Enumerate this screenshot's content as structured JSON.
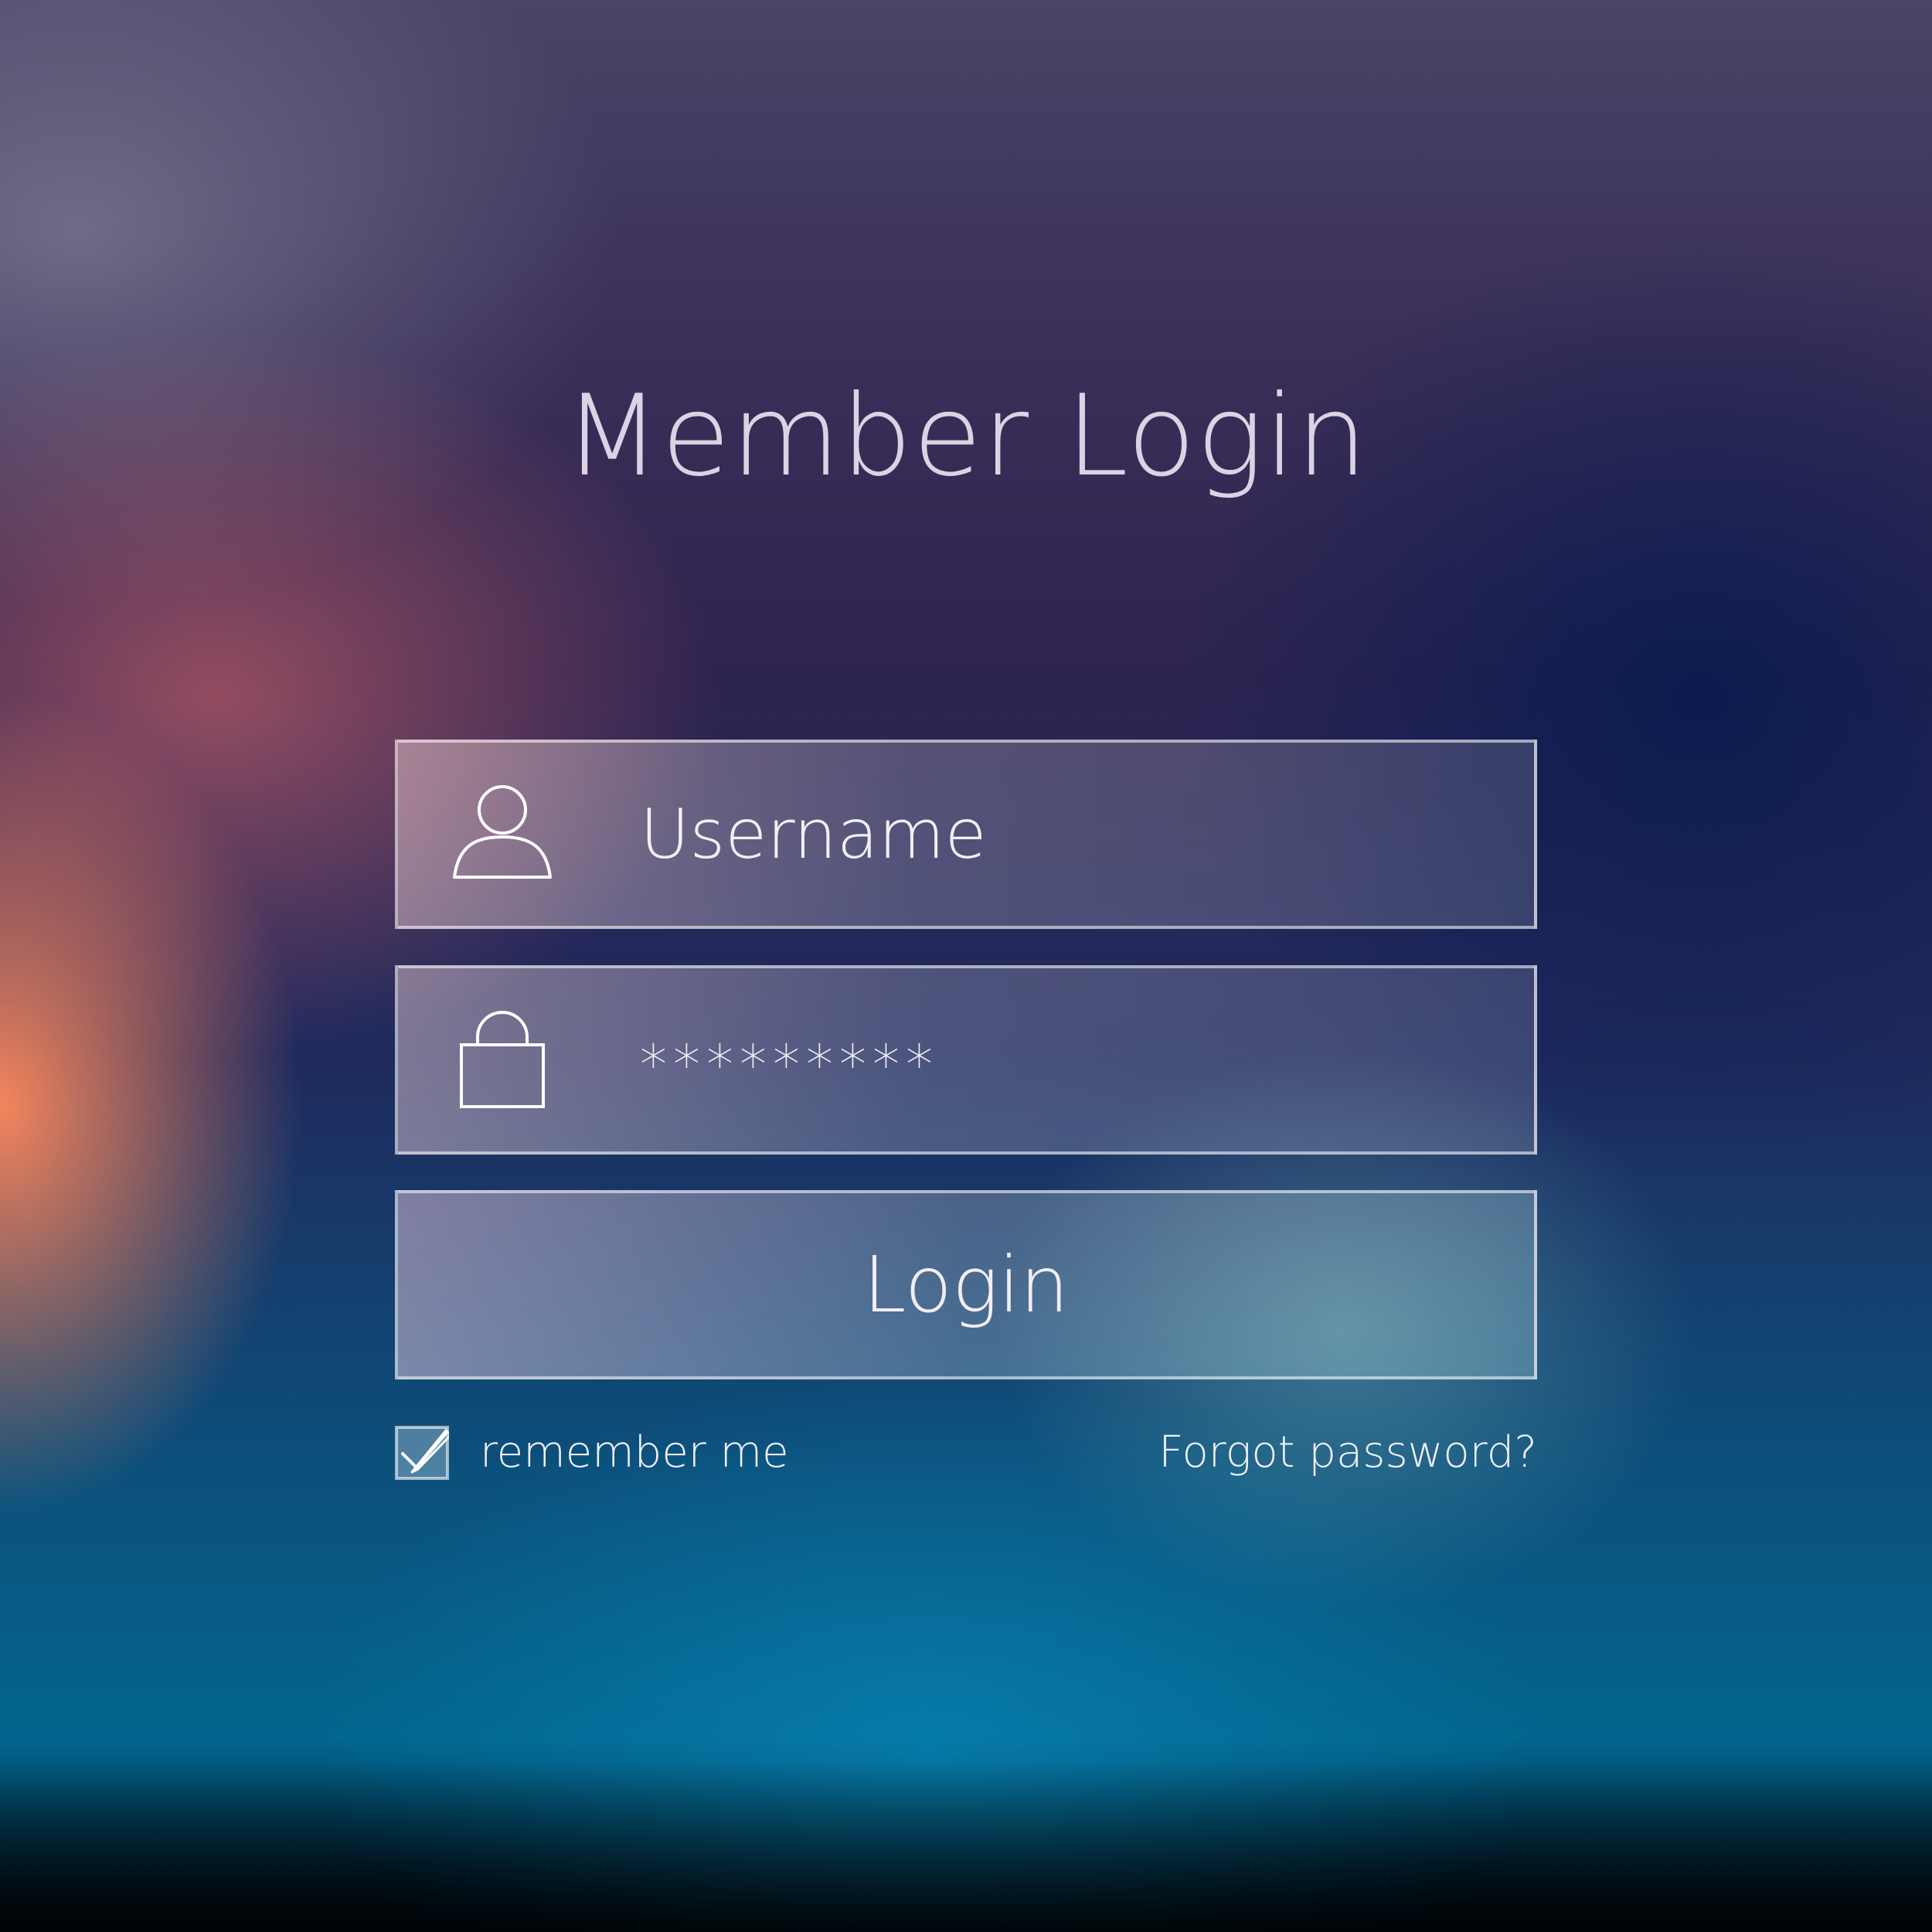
{
  "title": "Member Login",
  "username": {
    "placeholder": "Username",
    "icon": "user-icon"
  },
  "password": {
    "value": "*********",
    "icon": "lock-icon"
  },
  "login_button": {
    "label": "Login"
  },
  "remember": {
    "label": "remember me",
    "checked": true
  },
  "forgot": {
    "label": "Forgot password?"
  },
  "colors": {
    "text": "#e9e2ef",
    "field_border": "#ffffff",
    "accent_orange": "#ff8a5c",
    "deep_blue": "#001950",
    "teal": "#02658e"
  }
}
